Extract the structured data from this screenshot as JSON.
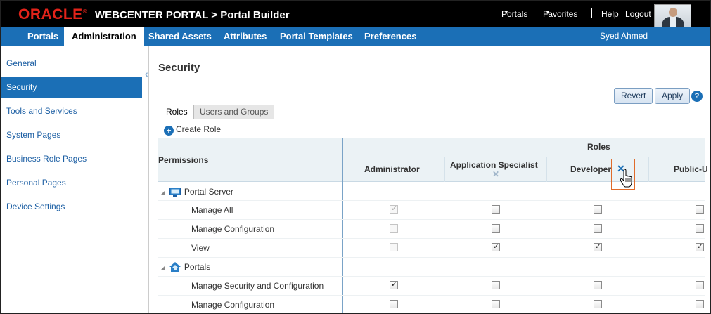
{
  "header": {
    "logo": "ORACLE",
    "app_title": "WEBCENTER PORTAL > Portal Builder",
    "links": {
      "portals": "Portals",
      "favorites": "Favorites",
      "help": "Help",
      "logout": "Logout"
    }
  },
  "nav": {
    "tabs": [
      "Portals",
      "Administration",
      "Shared Assets",
      "Attributes",
      "Portal Templates",
      "Preferences"
    ],
    "active_tab": "Administration",
    "user": "Syed Ahmed"
  },
  "sidebar": {
    "items": [
      "General",
      "Security",
      "Tools and Services",
      "System Pages",
      "Business Role Pages",
      "Personal Pages",
      "Device Settings"
    ],
    "active_item": "Security"
  },
  "page": {
    "title": "Security",
    "revert_label": "Revert",
    "apply_label": "Apply",
    "help_label": "?",
    "tabs": [
      "Roles",
      "Users and Groups"
    ],
    "active_tab": "Roles",
    "create_role_label": "Create Role"
  },
  "grid": {
    "permissions_header": "Permissions",
    "roles_header": "Roles",
    "roles": [
      "Administrator",
      "Application Specialist",
      "Developer",
      "Public-U"
    ],
    "groups": [
      {
        "name": "Portal Server",
        "icon": "portal-server-icon",
        "permissions": [
          {
            "label": "Manage All",
            "values": [
              true,
              false,
              false,
              false
            ],
            "disabled": [
              true,
              false,
              false,
              false
            ]
          },
          {
            "label": "Manage Configuration",
            "values": [
              false,
              false,
              false,
              false
            ],
            "disabled": [
              true,
              false,
              false,
              false
            ]
          },
          {
            "label": "View",
            "values": [
              false,
              true,
              true,
              true
            ],
            "disabled": [
              true,
              false,
              false,
              false
            ]
          }
        ]
      },
      {
        "name": "Portals",
        "icon": "portals-icon",
        "permissions": [
          {
            "label": "Manage Security and Configuration",
            "values": [
              true,
              false,
              false,
              false
            ],
            "disabled": [
              false,
              false,
              false,
              false
            ]
          },
          {
            "label": "Manage Configuration",
            "values": [
              false,
              false,
              false,
              false
            ],
            "disabled": [
              false,
              false,
              false,
              false
            ]
          }
        ]
      }
    ]
  },
  "colors": {
    "nav_blue": "#1b6fb6",
    "oracle_red": "#e2231a",
    "header_bg": "#000000"
  }
}
